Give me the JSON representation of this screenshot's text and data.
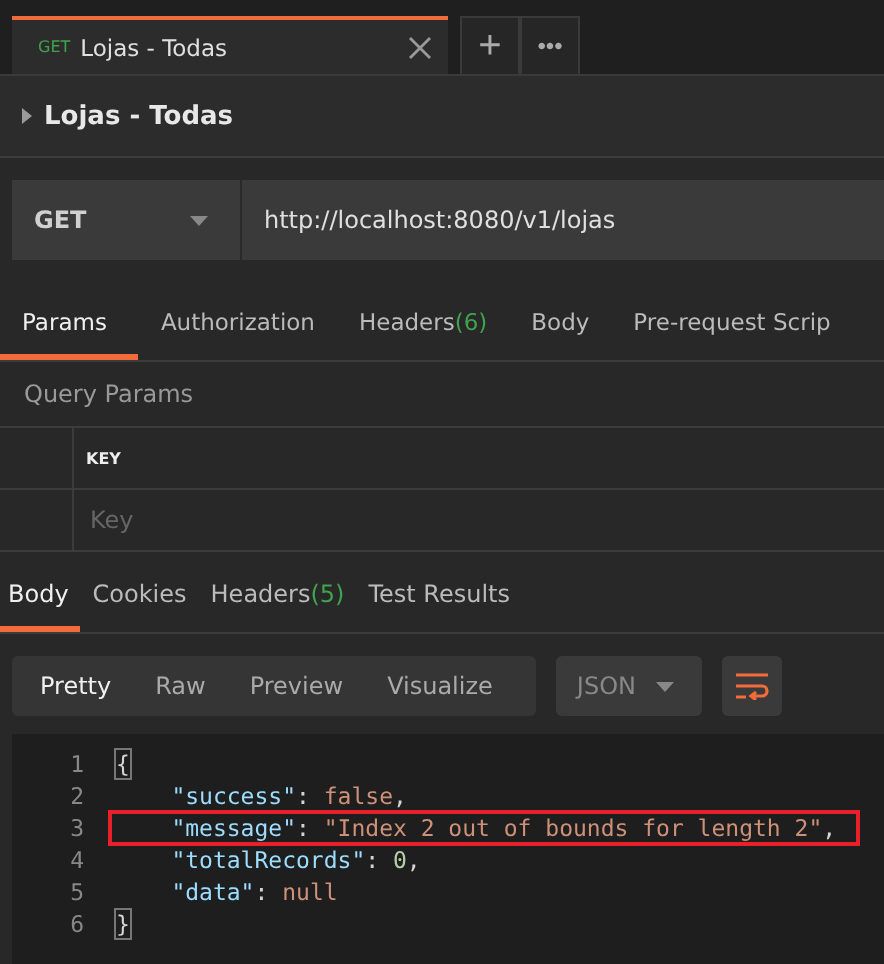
{
  "request_tabs": [
    {
      "method": "GET",
      "title": "Lojas - Todas",
      "selected": true
    }
  ],
  "new_tab_button": "+",
  "more_button": "•••",
  "request_name": "Lojas - Todas",
  "url_bar": {
    "method": "GET",
    "url": "http://localhost:8080/v1/lojas"
  },
  "request_sections": [
    {
      "label": "Params",
      "selected": true
    },
    {
      "label": "Authorization",
      "selected": false
    },
    {
      "label": "Headers",
      "count": "(6)",
      "selected": false
    },
    {
      "label": "Body",
      "selected": false
    },
    {
      "label": "Pre-request Scrip",
      "selected": false
    }
  ],
  "query_params": {
    "title": "Query Params",
    "column": "KEY",
    "placeholder": "Key"
  },
  "response_tabs": [
    {
      "label": "Body",
      "selected": true
    },
    {
      "label": "Cookies",
      "selected": false
    },
    {
      "label": "Headers",
      "count": "(5)",
      "selected": false
    },
    {
      "label": "Test Results",
      "selected": false
    }
  ],
  "view_modes": [
    {
      "label": "Pretty",
      "selected": true
    },
    {
      "label": "Raw",
      "selected": false
    },
    {
      "label": "Preview",
      "selected": false
    },
    {
      "label": "Visualize",
      "selected": false
    }
  ],
  "format_select": "JSON",
  "code_lines": [
    {
      "number": "1",
      "annotated": false,
      "tokens": [
        {
          "kind": "bracket",
          "text": "{"
        }
      ]
    },
    {
      "number": "2",
      "annotated": false,
      "tokens": [
        {
          "kind": "key",
          "text": "    \"success\""
        },
        {
          "kind": "punct",
          "text": ": "
        },
        {
          "kind": "literal",
          "text": "false"
        },
        {
          "kind": "punct",
          "text": ","
        }
      ]
    },
    {
      "number": "3",
      "annotated": true,
      "tokens": [
        {
          "kind": "key",
          "text": "    \"message\""
        },
        {
          "kind": "punct",
          "text": ": "
        },
        {
          "kind": "string",
          "text": "\"Index 2 out of bounds for length 2\""
        },
        {
          "kind": "punct",
          "text": ","
        }
      ]
    },
    {
      "number": "4",
      "annotated": false,
      "tokens": [
        {
          "kind": "key",
          "text": "    \"totalRecords\""
        },
        {
          "kind": "punct",
          "text": ": "
        },
        {
          "kind": "number",
          "text": "0"
        },
        {
          "kind": "punct",
          "text": ","
        }
      ]
    },
    {
      "number": "5",
      "annotated": false,
      "tokens": [
        {
          "kind": "key",
          "text": "    \"data\""
        },
        {
          "kind": "punct",
          "text": ": "
        },
        {
          "kind": "literal",
          "text": "null"
        }
      ]
    },
    {
      "number": "6",
      "annotated": false,
      "tokens": [
        {
          "kind": "bracket",
          "text": "}"
        }
      ]
    }
  ]
}
